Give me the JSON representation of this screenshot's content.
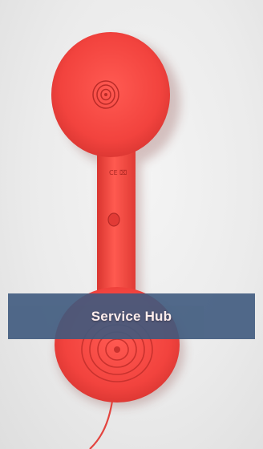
{
  "banner": {
    "label": "Service Hub"
  },
  "photo": {
    "subject": "red-telephone-handset-icon",
    "receiver_marking": "CE ⌧"
  },
  "colors": {
    "handset_red": "#f2433e",
    "banner_blue": "#3f5a7e",
    "background": "#ececec"
  }
}
